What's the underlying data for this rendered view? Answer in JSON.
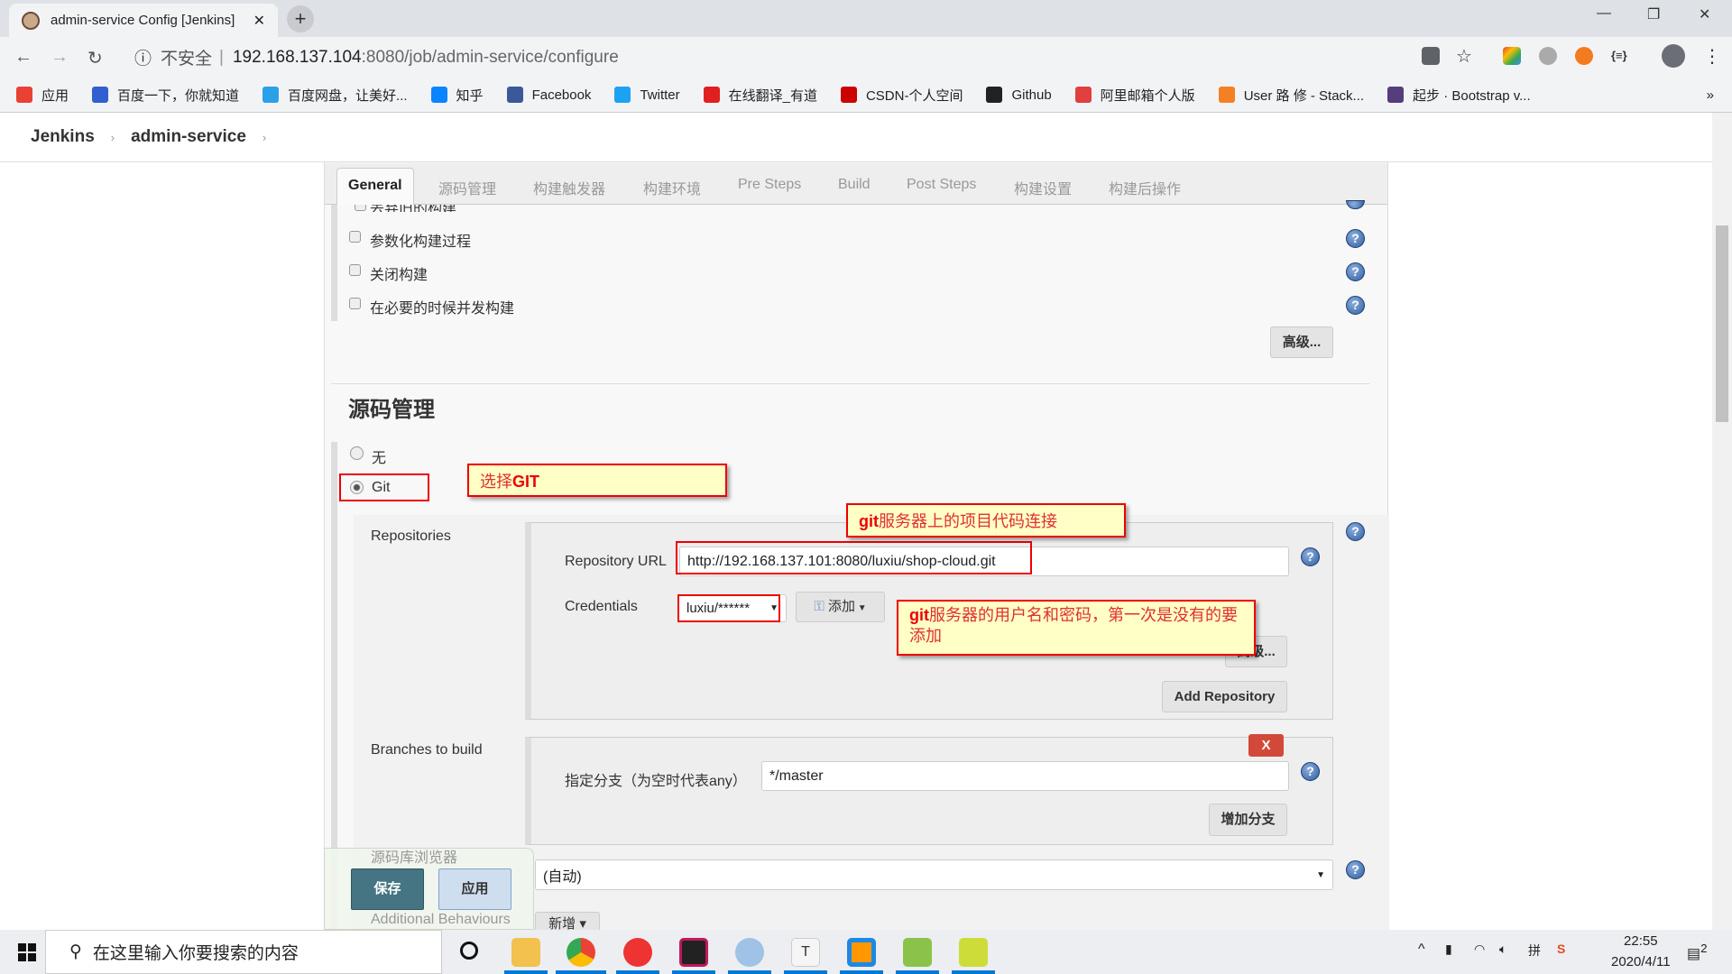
{
  "browser": {
    "tab_title": "admin-service Config [Jenkins]",
    "url_security": "不安全",
    "url_host": "192.168.137.104",
    "url_path": ":8080/job/admin-service/configure",
    "bookmarks": [
      {
        "label": "应用",
        "color": "#e94235"
      },
      {
        "label": "百度一下，你就知道",
        "color": "#3060d0"
      },
      {
        "label": "百度网盘，让美好...",
        "color": "#2aa0e8"
      },
      {
        "label": "知乎",
        "color": "#0a84ff"
      },
      {
        "label": "Facebook",
        "color": "#3b5998"
      },
      {
        "label": "Twitter",
        "color": "#1da1f2"
      },
      {
        "label": "在线翻译_有道",
        "color": "#e02020"
      },
      {
        "label": "CSDN-个人空间",
        "color": "#c00"
      },
      {
        "label": "Github",
        "color": "#222"
      },
      {
        "label": "阿里邮箱个人版",
        "color": "#e04040"
      },
      {
        "label": "User 路 修 - Stack...",
        "color": "#f48024"
      },
      {
        "label": "起步 · Bootstrap v...",
        "color": "#563d7c"
      }
    ],
    "more": "»"
  },
  "header": {
    "home": "Jenkins",
    "job": "admin-service"
  },
  "tabs": [
    "General",
    "源码管理",
    "构建触发器",
    "构建环境",
    "Pre Steps",
    "Build",
    "Post Steps",
    "构建设置",
    "构建后操作"
  ],
  "general": {
    "options": [
      "丢弃旧的构建",
      "参数化构建过程",
      "关闭构建",
      "在必要的时候并发构建"
    ],
    "advanced": "高级..."
  },
  "scm": {
    "title": "源码管理",
    "none": "无",
    "git": "Git",
    "selected": "Git",
    "repositories_label": "Repositories",
    "repo_url_label": "Repository URL",
    "repo_url": "http://192.168.137.101:8080/luxiu/shop-cloud.git",
    "credentials_label": "Credentials",
    "credentials": "luxiu/******",
    "add": "添加",
    "advanced": "高级...",
    "add_repository": "Add Repository",
    "branches_label": "Branches to build",
    "branch_spec_label": "指定分支（为空时代表any）",
    "branch_spec": "*/master",
    "delete": "X",
    "add_branch": "增加分支",
    "browser_label": "源码库浏览器",
    "browser_value": "(自动)",
    "additional_label": "Additional Behaviours",
    "new": "新增"
  },
  "annotations": {
    "select_git_prefix": "选择",
    "select_git_bold": "GIT",
    "repo_bold": "git",
    "repo_text": "服务器上的项目代码连接",
    "cred_bold": "git",
    "cred_text": "服务器的用户名和密码，第一次是没有的要添加"
  },
  "actions": {
    "save": "保存",
    "apply": "应用"
  },
  "taskbar": {
    "search_placeholder": "在这里输入你要搜索的内容",
    "time": "22:55",
    "date": "2020/4/11",
    "notifications": "2"
  }
}
